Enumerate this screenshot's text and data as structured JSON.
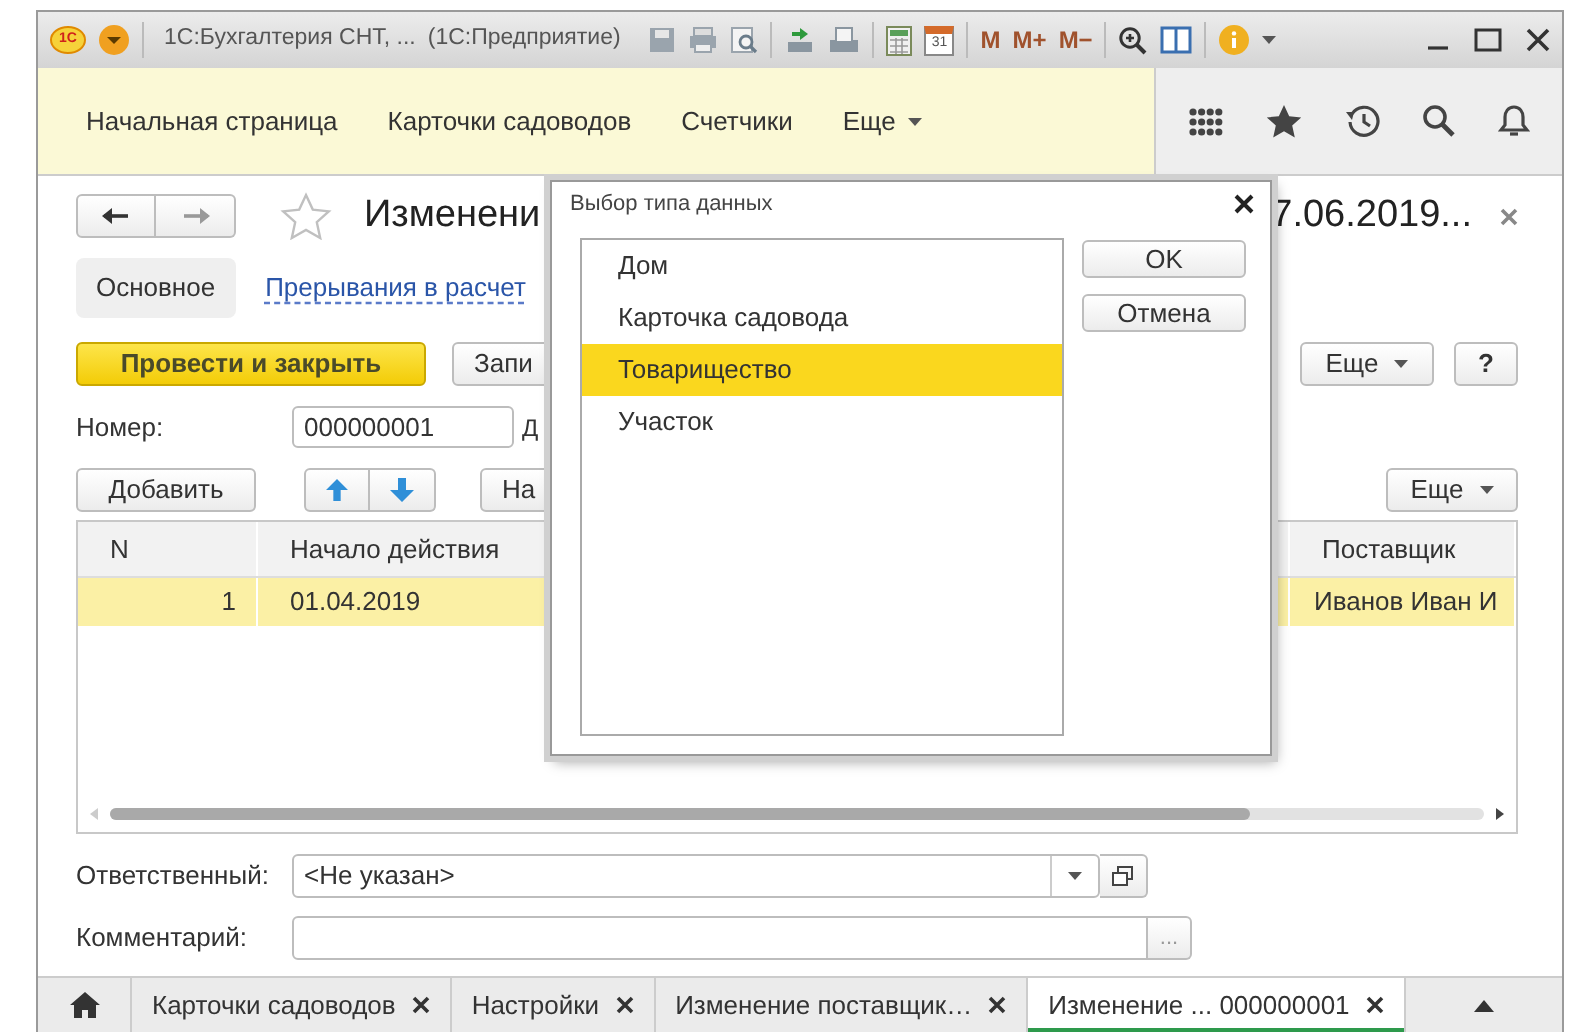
{
  "window": {
    "logo": "1С",
    "title": "1С:Бухгалтерия СНТ, ...",
    "app": "(1С:Предприятие)",
    "calendar_day": "31",
    "memory_buttons": [
      "M",
      "M+",
      "M−"
    ]
  },
  "nav": {
    "items": [
      {
        "label": "Начальная страница",
        "dropdown": false
      },
      {
        "label": "Карточки садоводов",
        "dropdown": false
      },
      {
        "label": "Счетчики",
        "dropdown": false
      },
      {
        "label": "Еще",
        "dropdown": true
      }
    ]
  },
  "document": {
    "title_start": "Изменени",
    "title_end": "7.06.2019...",
    "tabs": [
      {
        "label": "Основное",
        "selected": true
      },
      {
        "label": "Прерывания в расчет",
        "selected": false
      }
    ],
    "buttons": {
      "post_close": "Провести и закрыть",
      "write": "Запи",
      "more": "Еще",
      "help": "?"
    },
    "number": {
      "label": "Номер:",
      "value": "000000001"
    },
    "date_label": "Д",
    "table_toolbar": {
      "add": "Добавить",
      "fill": "На",
      "more": "Еще"
    },
    "table": {
      "columns": [
        "N",
        "Начало действия",
        "Поставщик"
      ],
      "rows": [
        {
          "cells": [
            "1",
            "01.04.2019",
            "Иванов Иван И"
          ],
          "selected": true
        }
      ]
    },
    "responsible": {
      "label": "Ответственный:",
      "value": "<Не указан>"
    },
    "comment": {
      "label": "Комментарий:",
      "button": "..."
    }
  },
  "dialog": {
    "title": "Выбор типа данных",
    "items": [
      {
        "label": "Дом",
        "selected": false
      },
      {
        "label": "Карточка садовода",
        "selected": false
      },
      {
        "label": "Товарищество",
        "selected": true
      },
      {
        "label": "Участок",
        "selected": false
      }
    ],
    "buttons": [
      "OK",
      "Отмена"
    ]
  },
  "open_tabs": [
    {
      "label": "Карточки садоводов",
      "selected": false
    },
    {
      "label": "Настройки",
      "selected": false
    },
    {
      "label": "Изменение поставщик…",
      "selected": false
    },
    {
      "label": "Изменение ... 000000001",
      "selected": true
    }
  ]
}
